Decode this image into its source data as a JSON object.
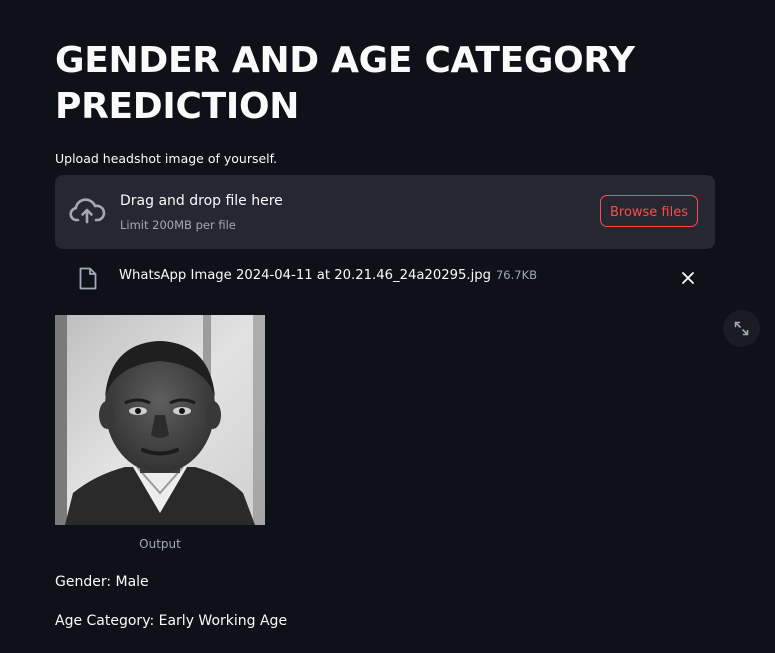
{
  "title": "GENDER AND AGE CATEGORY PREDICTION",
  "uploader": {
    "label": "Upload headshot image of yourself.",
    "drop_title": "Drag and drop file here",
    "drop_limit": "Limit 200MB per file",
    "browse_label": "Browse files",
    "icon": "cloud-upload-icon"
  },
  "uploaded_file": {
    "name": "WhatsApp Image 2024-04-11 at 20.21.46_24a20295.jpg",
    "size": "76.7KB",
    "icon": "file-icon",
    "remove_icon": "close-icon"
  },
  "image": {
    "caption": "Output",
    "fullscreen_icon": "expand-icon"
  },
  "results": {
    "gender": "Gender: Male",
    "age_category": "Age Category: Early Working Age"
  },
  "colors": {
    "background": "#0e1117",
    "panel": "#262730",
    "accent": "#ff4b4b",
    "text": "#fafafa",
    "muted_text": "#a3a8b8"
  }
}
